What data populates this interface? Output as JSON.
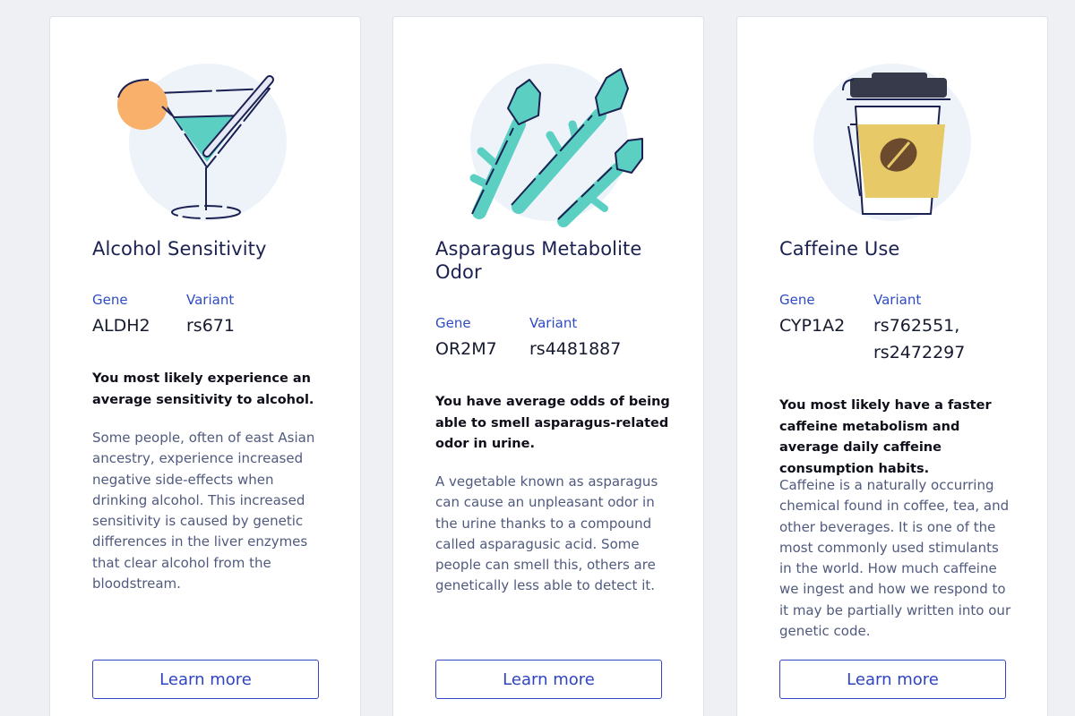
{
  "colors": {
    "accent": "#2f44c0",
    "title": "#1b2152",
    "body_text": "#505a7e",
    "teal": "#5ccfc3",
    "orange": "#f8b06a",
    "coffee_gold": "#e8c968",
    "illustration_bg": "#eef3fa"
  },
  "cards": [
    {
      "illustration": "cocktail-icon",
      "title": "Alcohol Sensitivity",
      "gene_label": "Gene",
      "gene": "ALDH2",
      "variant_label": "Variant",
      "variant_line1": "rs671",
      "variant_line2": "",
      "summary": "You most likely experience an average sensitivity to alcohol.",
      "description": "Some people, often of east Asian ancestry, experience increased negative side-effects when drinking alcohol. This increased sensitivity is caused by genetic differences in the liver enzymes that clear alcohol from the bloodstream.",
      "button": "Learn more"
    },
    {
      "illustration": "asparagus-icon",
      "title": "Asparagus Metabolite Odor",
      "gene_label": "Gene",
      "gene": "OR2M7",
      "variant_label": "Variant",
      "variant_line1": "rs4481887",
      "variant_line2": "",
      "summary": "You have average odds of being able to smell asparagus-related odor in urine.",
      "description": "A vegetable known as asparagus can cause an unpleasant odor in the urine thanks to a compound called asparagusic acid. Some people can smell this, others are genetically less able to detect it.",
      "button": "Learn more"
    },
    {
      "illustration": "coffee-cup-icon",
      "title": "Caffeine Use",
      "gene_label": "Gene",
      "gene": "CYP1A2",
      "variant_label": "Variant",
      "variant_line1": "rs762551,",
      "variant_line2": "rs2472297",
      "summary": "You most likely have a faster caffeine metabolism and average daily caffeine consumption habits.",
      "description": "Caffeine is a naturally occurring chemical found in coffee, tea, and other beverages. It is one of the most commonly used stimulants in the world. How much caffeine we ingest and how we respond to it may be partially written into our genetic code.",
      "button": "Learn more"
    }
  ]
}
